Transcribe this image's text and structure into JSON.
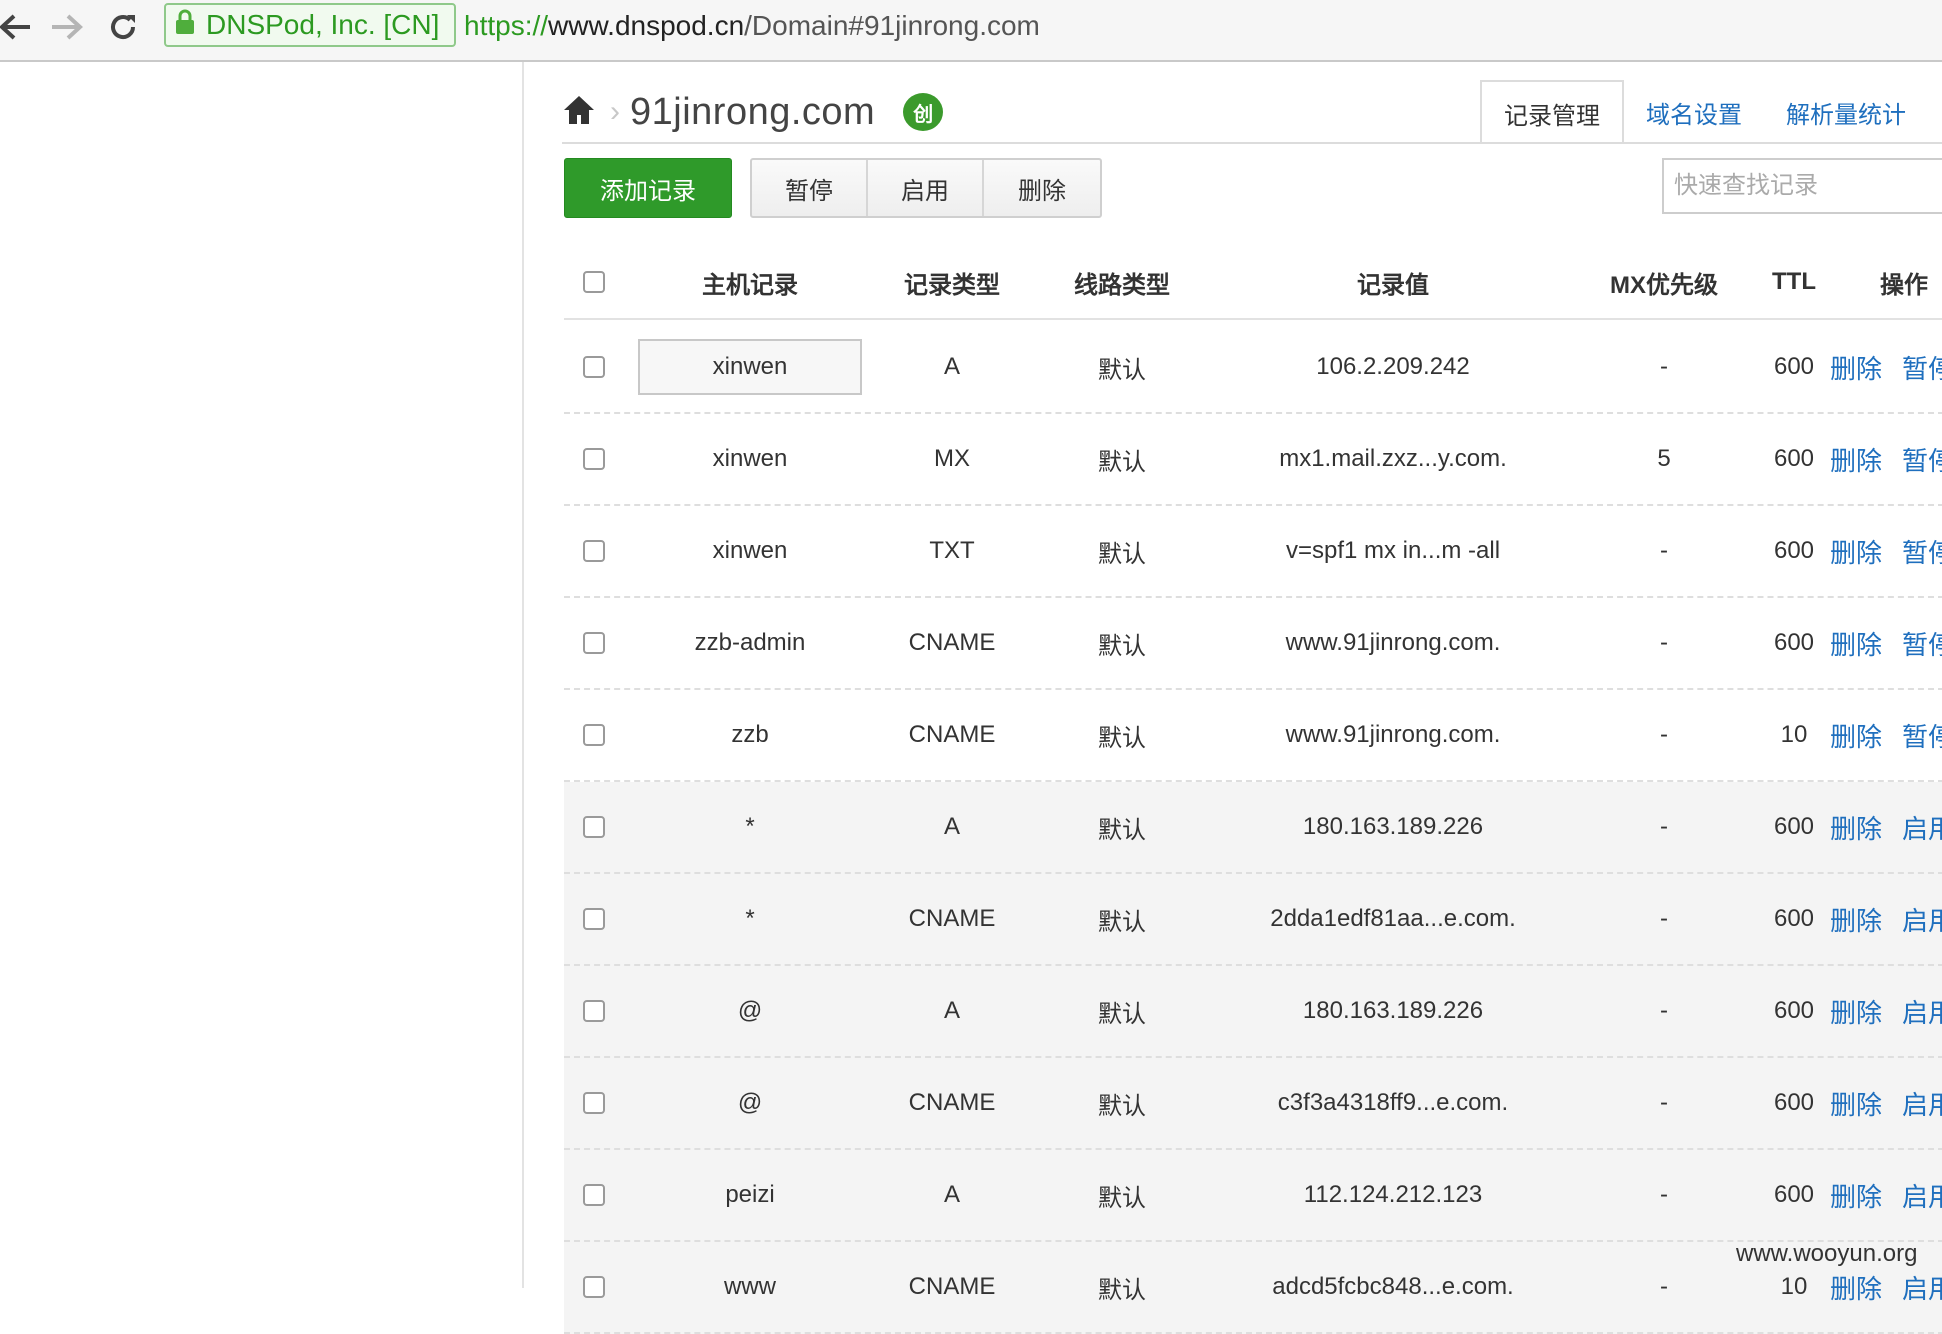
{
  "browser": {
    "security_label": "DNSPod, Inc. [CN]",
    "url_scheme": "https://",
    "url_host": "www.dnspod.cn",
    "url_path": "/Domain#91jinrong.com"
  },
  "header": {
    "domain": "91jinrong.com",
    "badge_text": "创"
  },
  "tabs": [
    {
      "label": "记录管理",
      "active": true
    },
    {
      "label": "域名设置",
      "active": false
    },
    {
      "label": "解析量统计",
      "active": false
    }
  ],
  "toolbar": {
    "add_label": "添加记录",
    "pause_label": "暂停",
    "enable_label": "启用",
    "delete_label": "删除",
    "search_placeholder": "快速查找记录"
  },
  "table": {
    "headers": {
      "host": "主机记录",
      "type": "记录类型",
      "line": "线路类型",
      "value": "记录值",
      "mx": "MX优先级",
      "ttl": "TTL",
      "ops": "操作"
    },
    "rows": [
      {
        "host": "xinwen",
        "type": "A",
        "line": "默认",
        "value": "106.2.209.242",
        "mx": "-",
        "ttl": "600",
        "op1": "删除",
        "op2": "暂停",
        "paused": false
      },
      {
        "host": "xinwen",
        "type": "MX",
        "line": "默认",
        "value": "mx1.mail.zxz...y.com.",
        "mx": "5",
        "ttl": "600",
        "op1": "删除",
        "op2": "暂停",
        "paused": false
      },
      {
        "host": "xinwen",
        "type": "TXT",
        "line": "默认",
        "value": "v=spf1 mx in...m -all",
        "mx": "-",
        "ttl": "600",
        "op1": "删除",
        "op2": "暂停",
        "paused": false
      },
      {
        "host": "zzb-admin",
        "type": "CNAME",
        "line": "默认",
        "value": "www.91jinrong.com.",
        "mx": "-",
        "ttl": "600",
        "op1": "删除",
        "op2": "暂停",
        "paused": false
      },
      {
        "host": "zzb",
        "type": "CNAME",
        "line": "默认",
        "value": "www.91jinrong.com.",
        "mx": "-",
        "ttl": "10",
        "op1": "删除",
        "op2": "暂停",
        "paused": false
      },
      {
        "host": "*",
        "type": "A",
        "line": "默认",
        "value": "180.163.189.226",
        "mx": "-",
        "ttl": "600",
        "op1": "删除",
        "op2": "启用",
        "paused": true
      },
      {
        "host": "*",
        "type": "CNAME",
        "line": "默认",
        "value": "2dda1edf81aa...e.com.",
        "mx": "-",
        "ttl": "600",
        "op1": "删除",
        "op2": "启用",
        "paused": true
      },
      {
        "host": "@",
        "type": "A",
        "line": "默认",
        "value": "180.163.189.226",
        "mx": "-",
        "ttl": "600",
        "op1": "删除",
        "op2": "启用",
        "paused": true
      },
      {
        "host": "@",
        "type": "CNAME",
        "line": "默认",
        "value": "c3f3a4318ff9...e.com.",
        "mx": "-",
        "ttl": "600",
        "op1": "删除",
        "op2": "启用",
        "paused": true
      },
      {
        "host": "peizi",
        "type": "A",
        "line": "默认",
        "value": "112.124.212.123",
        "mx": "-",
        "ttl": "600",
        "op1": "删除",
        "op2": "启用",
        "paused": true
      },
      {
        "host": "www",
        "type": "CNAME",
        "line": "默认",
        "value": "adcd5fcbc848...e.com.",
        "mx": "-",
        "ttl": "10",
        "op1": "删除",
        "op2": "启用",
        "paused": true
      }
    ]
  },
  "watermark": "www.wooyun.org"
}
